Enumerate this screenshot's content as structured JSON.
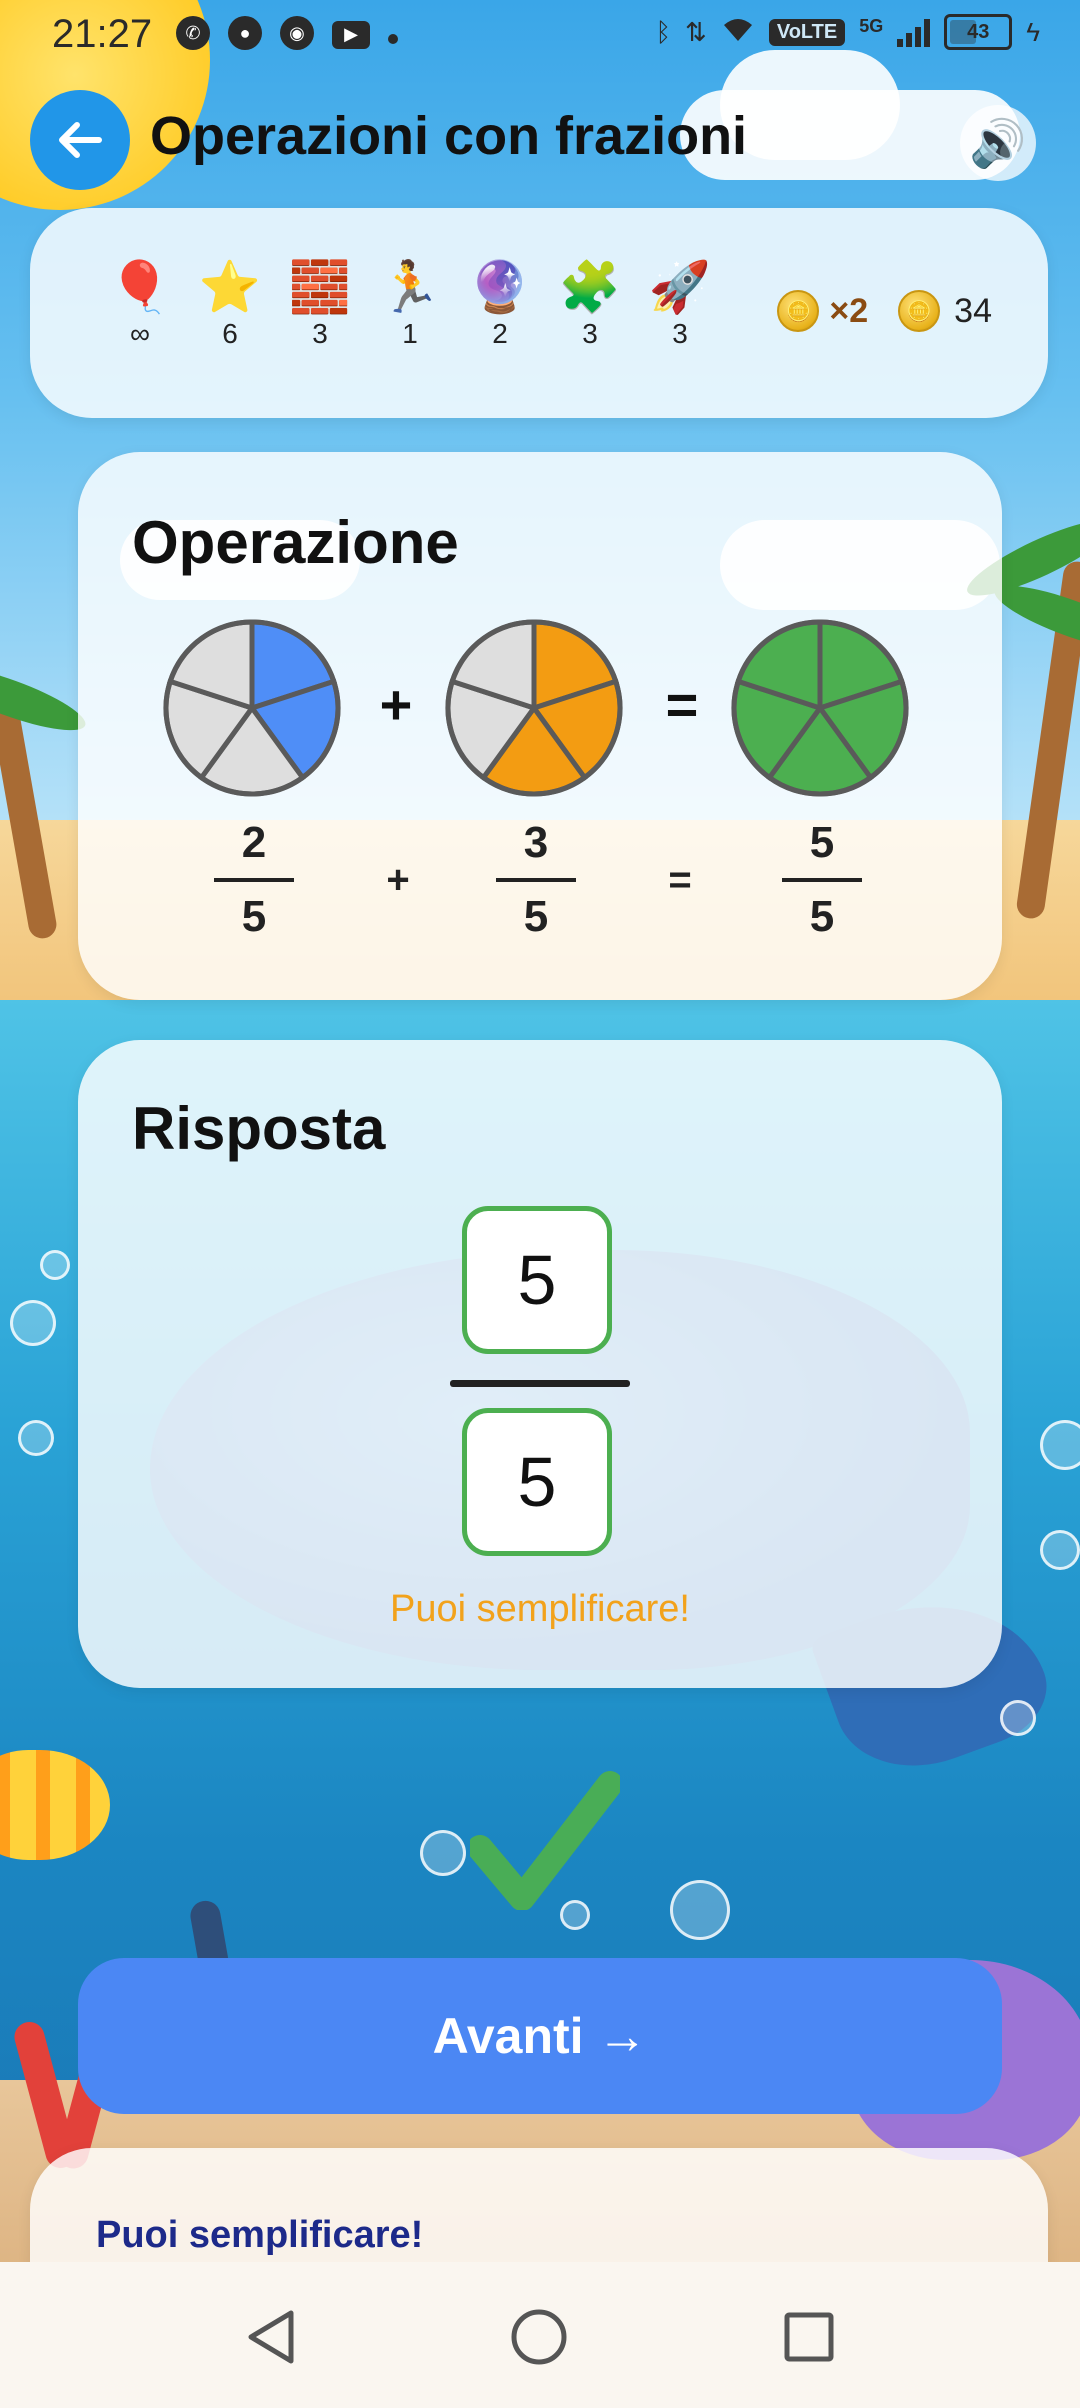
{
  "status_bar": {
    "time": "21:27",
    "network": "5G",
    "volte": "VoLTE",
    "battery": "43"
  },
  "header": {
    "title": "Operazioni con frazioni",
    "back_icon": "arrow-left-icon",
    "sound_icon": "speaker-icon"
  },
  "inventory": {
    "items": [
      {
        "icon": "🎈",
        "name": "balloon",
        "count": "∞"
      },
      {
        "icon": "⭐",
        "name": "star",
        "count": "6"
      },
      {
        "icon": "🧱",
        "name": "brick",
        "count": "3"
      },
      {
        "icon": "🏃",
        "name": "runner",
        "count": "1"
      },
      {
        "icon": "🔮",
        "name": "crystal-ball",
        "count": "2"
      },
      {
        "icon": "🧩",
        "name": "puzzle",
        "count": "3"
      },
      {
        "icon": "🚀",
        "name": "rocket",
        "count": "3"
      }
    ],
    "multiplier": "×2",
    "coins": "34"
  },
  "operation": {
    "title": "Operazione",
    "plus_sign": "+",
    "equals_sign": "=",
    "fractions": [
      {
        "numerator": "2",
        "denominator": "5",
        "color": "#4f8ef7",
        "filled": 2,
        "parts": 5
      },
      {
        "numerator": "3",
        "denominator": "5",
        "color": "#f39c12",
        "filled": 3,
        "parts": 5
      },
      {
        "numerator": "5",
        "denominator": "5",
        "color": "#4caf50",
        "filled": 5,
        "parts": 5
      }
    ]
  },
  "answer": {
    "title": "Risposta",
    "numerator": "5",
    "denominator": "5",
    "hint": "Puoi semplificare!"
  },
  "check_icon": "checkmark-icon",
  "next_button": {
    "label": "Avanti →"
  },
  "feedback": {
    "text": "Puoi semplificare!"
  },
  "colors": {
    "accent_blue": "#4b87f4",
    "back_blue": "#2196e8",
    "success_green": "#4caf50",
    "hint_orange": "#f2a21b",
    "feedback_navy": "#1d2a8a"
  }
}
